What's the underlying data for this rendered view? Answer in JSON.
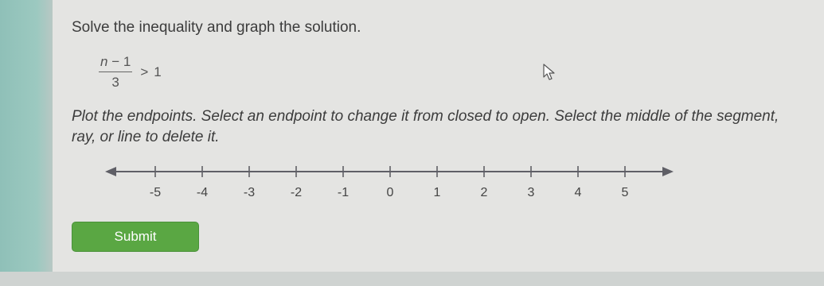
{
  "question": {
    "prompt": "Solve the inequality and graph the solution.",
    "inequality": {
      "numerator_var": "n",
      "numerator_rest": " − 1",
      "denominator": "3",
      "operator": ">",
      "rhs": "1"
    },
    "instructions": "Plot the endpoints. Select an endpoint to change it from closed to open. Select the middle of the segment, ray, or line to delete it."
  },
  "number_line": {
    "min": -5,
    "max": 5,
    "ticks": [
      {
        "label": "-5"
      },
      {
        "label": "-4"
      },
      {
        "label": "-3"
      },
      {
        "label": "-2"
      },
      {
        "label": "-1"
      },
      {
        "label": "0"
      },
      {
        "label": "1"
      },
      {
        "label": "2"
      },
      {
        "label": "3"
      },
      {
        "label": "4"
      },
      {
        "label": "5"
      }
    ],
    "line_color": "#5f5f66"
  },
  "submit": {
    "label": "Submit",
    "color": "#5aa743"
  },
  "cursor": {
    "icon": "mouse-pointer-icon"
  }
}
